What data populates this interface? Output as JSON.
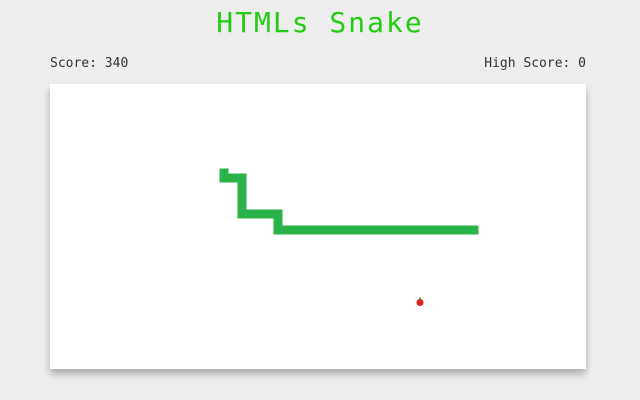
{
  "game": {
    "title": "HTMLs Snake"
  },
  "scoreboard": {
    "score_label": "Score: 340",
    "high_score_label": "High Score: 0",
    "score": 340,
    "high_score": 0
  },
  "colors": {
    "background": "#eeeeee",
    "title": "#22cc11",
    "snake": "#2ab34a",
    "apple": "#dd2222",
    "apple_leaf": "#3a7d1e",
    "board": "#ffffff"
  },
  "icons": {
    "food": "apple-icon"
  }
}
